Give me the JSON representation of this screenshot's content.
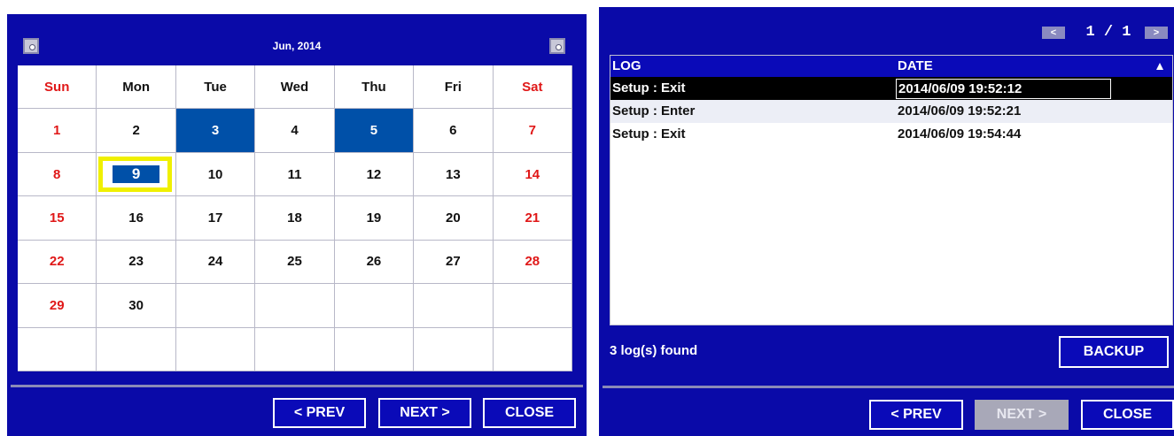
{
  "calendar": {
    "title": "Jun, 2014",
    "weekdays": [
      "Sun",
      "Mon",
      "Tue",
      "Wed",
      "Thu",
      "Fri",
      "Sat"
    ],
    "weeks": [
      [
        "1",
        "2",
        "3",
        "4",
        "5",
        "6",
        "7"
      ],
      [
        "8",
        "9",
        "10",
        "11",
        "12",
        "13",
        "14"
      ],
      [
        "15",
        "16",
        "17",
        "18",
        "19",
        "20",
        "21"
      ],
      [
        "22",
        "23",
        "24",
        "25",
        "26",
        "27",
        "28"
      ],
      [
        "29",
        "30",
        "",
        "",
        "",
        "",
        ""
      ],
      [
        "",
        "",
        "",
        "",
        "",
        "",
        ""
      ]
    ],
    "highlighted_days": [
      "3",
      "5"
    ],
    "selected_day": "9",
    "buttons": {
      "prev": "< PREV",
      "next": "NEXT >",
      "close": "CLOSE"
    },
    "colors": {
      "weekend": "#e01818",
      "highlight": "#0050a8",
      "selection_border": "#f0f000",
      "panel": "#0a0aa8"
    }
  },
  "log": {
    "pager": {
      "text": "1 / 1"
    },
    "columns": {
      "log": "LOG",
      "date": "DATE"
    },
    "rows": [
      {
        "log": "Setup : Exit",
        "date": "2014/06/09 19:52:12"
      },
      {
        "log": "Setup : Enter",
        "date": "2014/06/09 19:52:21"
      },
      {
        "log": "Setup : Exit",
        "date": "2014/06/09 19:54:44"
      }
    ],
    "selected_row": 0,
    "count_text": "3 log(s) found",
    "buttons": {
      "backup": "BACKUP",
      "prev": "< PREV",
      "next": "NEXT >",
      "close": "CLOSE"
    },
    "icons": {
      "sort": "sort-ascending-icon",
      "pager_prev": "page-prev-icon",
      "pager_next": "page-next-icon"
    }
  }
}
